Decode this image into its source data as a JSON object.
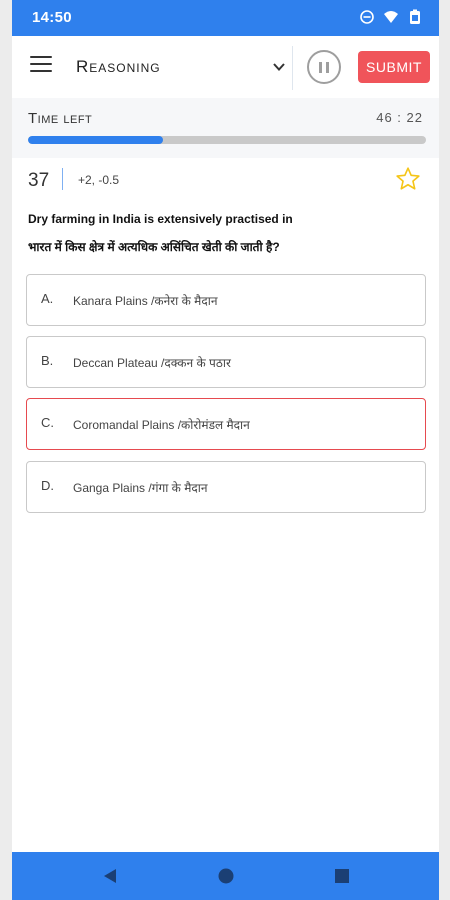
{
  "status_bar": {
    "time": "14:50",
    "icons": [
      "do-not-disturb-icon",
      "wifi-icon",
      "battery-icon"
    ]
  },
  "header": {
    "section": "Reasoning",
    "submit_label": "SUBMIT"
  },
  "timer": {
    "label": "Time left",
    "value": "46 : 22",
    "progress": 0.34
  },
  "question": {
    "number": "37",
    "marks": "+2, -0.5",
    "text_en": "Dry farming in India is extensively practised in",
    "text_hi": "भारत में किस क्षेत्र में अत्यधिक असिंचित खेती की जाती है?",
    "options": [
      {
        "letter": "A.",
        "text": "Kanara Plains /कनेरा के मैदान"
      },
      {
        "letter": "B.",
        "text": "Deccan Plateau /दक्कन के पठार"
      },
      {
        "letter": "C.",
        "text": "Coromandal Plains /कोरोमंडल मैदान"
      },
      {
        "letter": "D.",
        "text": "Ganga Plains /गंगा के मैदान"
      }
    ],
    "selected": "C."
  },
  "colors": {
    "primary": "#2f80ed",
    "submit": "#f0545a",
    "selected_border": "#e64a4f",
    "star": "#f5c518"
  }
}
